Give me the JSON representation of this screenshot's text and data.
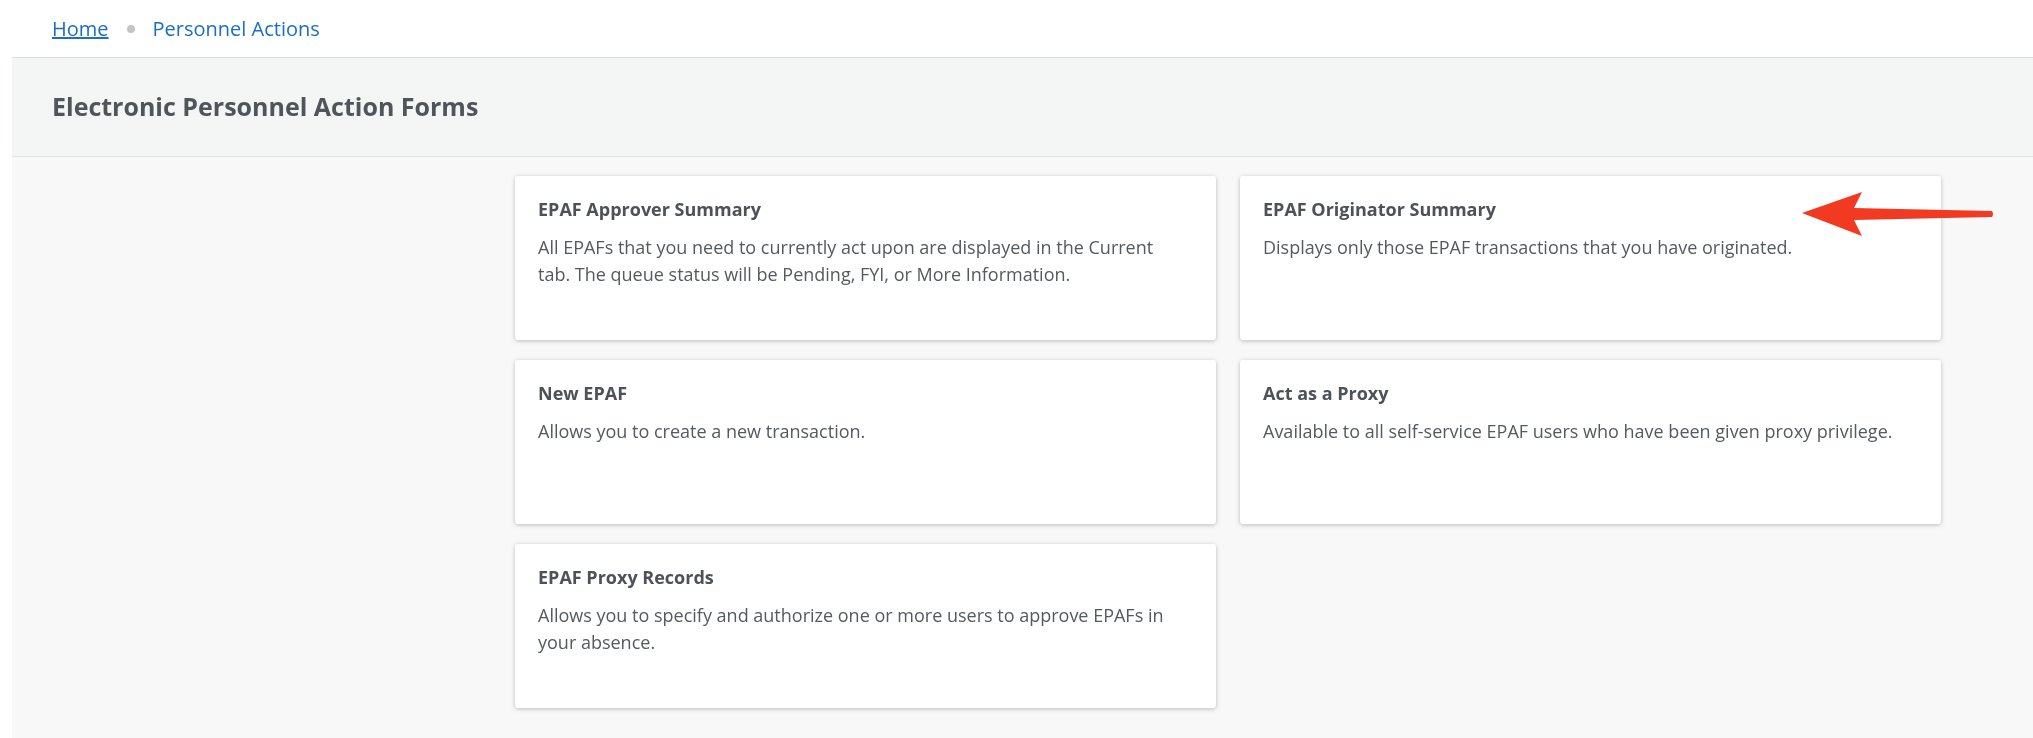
{
  "breadcrumb": [
    {
      "label": "Home",
      "current": false
    },
    {
      "label": "Personnel Actions",
      "current": true
    }
  ],
  "page_title": "Electronic Personnel Action Forms",
  "cards": [
    {
      "title": "EPAF Approver Summary",
      "description": "All EPAFs that you need to currently act upon are displayed in the Current tab. The queue status will be Pending, FYI, or More Information."
    },
    {
      "title": "EPAF Originator Summary",
      "description": "Displays only those EPAF transactions that you have originated."
    },
    {
      "title": "New EPAF",
      "description": "Allows you to create a new transaction."
    },
    {
      "title": "Act as a Proxy",
      "description": "Available to all self-service EPAF users who have been given proxy privilege."
    },
    {
      "title": "EPAF Proxy Records",
      "description": "Allows you to specify and authorize one or more users to approve EPAFs in your absence."
    }
  ]
}
